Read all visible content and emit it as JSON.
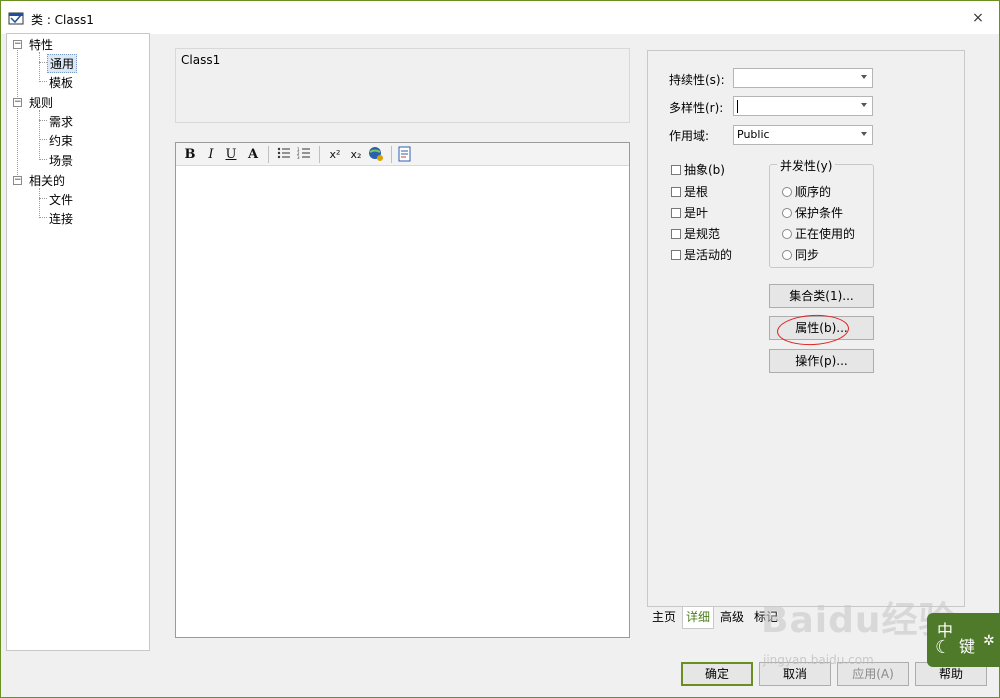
{
  "window": {
    "title": "类 : Class1",
    "close_glyph": "×"
  },
  "tree": {
    "nodes": [
      {
        "label": "特性",
        "expander": "−"
      },
      {
        "label": "通用"
      },
      {
        "label": "模板"
      },
      {
        "label": "规则",
        "expander": "−"
      },
      {
        "label": "需求"
      },
      {
        "label": "约束"
      },
      {
        "label": "场景"
      },
      {
        "label": "相关的",
        "expander": "−"
      },
      {
        "label": "文件"
      },
      {
        "label": "连接"
      }
    ]
  },
  "name_box": {
    "value": "Class1"
  },
  "toolbar": {
    "bold": "B",
    "italic": "I",
    "underline": "U",
    "font_color": "A",
    "superscript": "x²",
    "subscript": "x₂"
  },
  "details": {
    "persistence_label": "持续性(s):",
    "persistence_value": "",
    "multiplicity_label": "多样性(r):",
    "multiplicity_value": "",
    "scope_label": "作用域:",
    "scope_value": "Public",
    "checkboxes": [
      "抽象(b)",
      "是根",
      "是叶",
      "是规范",
      "是活动的"
    ],
    "concurrency_title": "并发性(y)",
    "radios": [
      "顺序的",
      "保护条件",
      "正在使用的",
      "同步"
    ],
    "collection_button": "集合类(1)...",
    "attributes_button": "属性(b)...",
    "operations_button": "操作(p)..."
  },
  "tabs": [
    "主页",
    "详细",
    "高级",
    "标记"
  ],
  "buttons": {
    "ok": "确定",
    "cancel": "取消",
    "apply": "应用(A)",
    "help": "帮助"
  },
  "watermark": {
    "text": "Baidu经验",
    "url": "jingyan.baidu.com"
  },
  "ime": {
    "label_top": "中",
    "label_bottom": "键"
  },
  "colors": {
    "accent": "#6b8e23",
    "annotation": "#e02020"
  }
}
